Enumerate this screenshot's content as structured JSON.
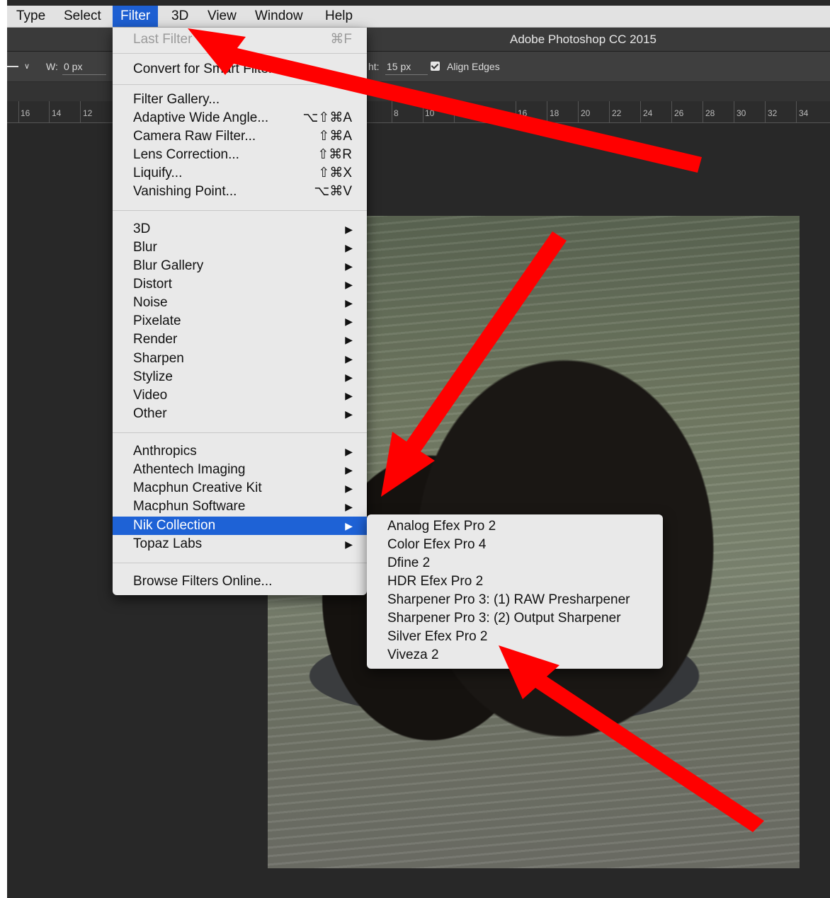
{
  "menubar": {
    "items": [
      {
        "label": "Type"
      },
      {
        "label": "Select"
      },
      {
        "label": "Filter"
      },
      {
        "label": "3D"
      },
      {
        "label": "View"
      },
      {
        "label": "Window"
      },
      {
        "label": "Help"
      }
    ]
  },
  "window": {
    "title": "Adobe Photoshop CC 2015"
  },
  "options": {
    "width_label": "W:",
    "width_value": "0 px",
    "height_label": "ht:",
    "height_value": "15 px",
    "align_edges_label": "Align Edges",
    "align_edges_checked": true
  },
  "ruler": {
    "ticks": [
      "16",
      "14",
      "12",
      "8",
      "10",
      "12",
      "16",
      "18",
      "20",
      "22",
      "24",
      "26",
      "28",
      "30",
      "32",
      "34"
    ]
  },
  "filter_menu": {
    "last_filter": {
      "label": "Last Filter",
      "shortcut": "⌘F"
    },
    "convert_smart": "Convert for Smart Filters",
    "group1": [
      {
        "label": "Filter Gallery...",
        "shortcut": ""
      },
      {
        "label": "Adaptive Wide Angle...",
        "shortcut": "⌥⇧⌘A"
      },
      {
        "label": "Camera Raw Filter...",
        "shortcut": "⇧⌘A"
      },
      {
        "label": "Lens Correction...",
        "shortcut": "⇧⌘R"
      },
      {
        "label": "Liquify...",
        "shortcut": "⇧⌘X"
      },
      {
        "label": "Vanishing Point...",
        "shortcut": "⌥⌘V"
      }
    ],
    "group2": [
      "3D",
      "Blur",
      "Blur Gallery",
      "Distort",
      "Noise",
      "Pixelate",
      "Render",
      "Sharpen",
      "Stylize",
      "Video",
      "Other"
    ],
    "group3": [
      "Anthropics",
      "Athentech Imaging",
      "Macphun Creative Kit",
      "Macphun Software",
      "Nik Collection",
      "Topaz Labs"
    ],
    "browse": "Browse Filters Online...",
    "submenu_arrow": "▶"
  },
  "nik_submenu": {
    "items": [
      "Analog Efex Pro 2",
      "Color Efex Pro 4",
      "Dfine 2",
      "HDR Efex Pro 2",
      "Sharpener Pro 3: (1) RAW Presharpener",
      "Sharpener Pro 3: (2) Output Sharpener",
      "Silver Efex Pro 2",
      "Viveza 2"
    ]
  },
  "colors": {
    "highlight": "#1e62d6",
    "annotation_arrow": "#ff0000"
  }
}
